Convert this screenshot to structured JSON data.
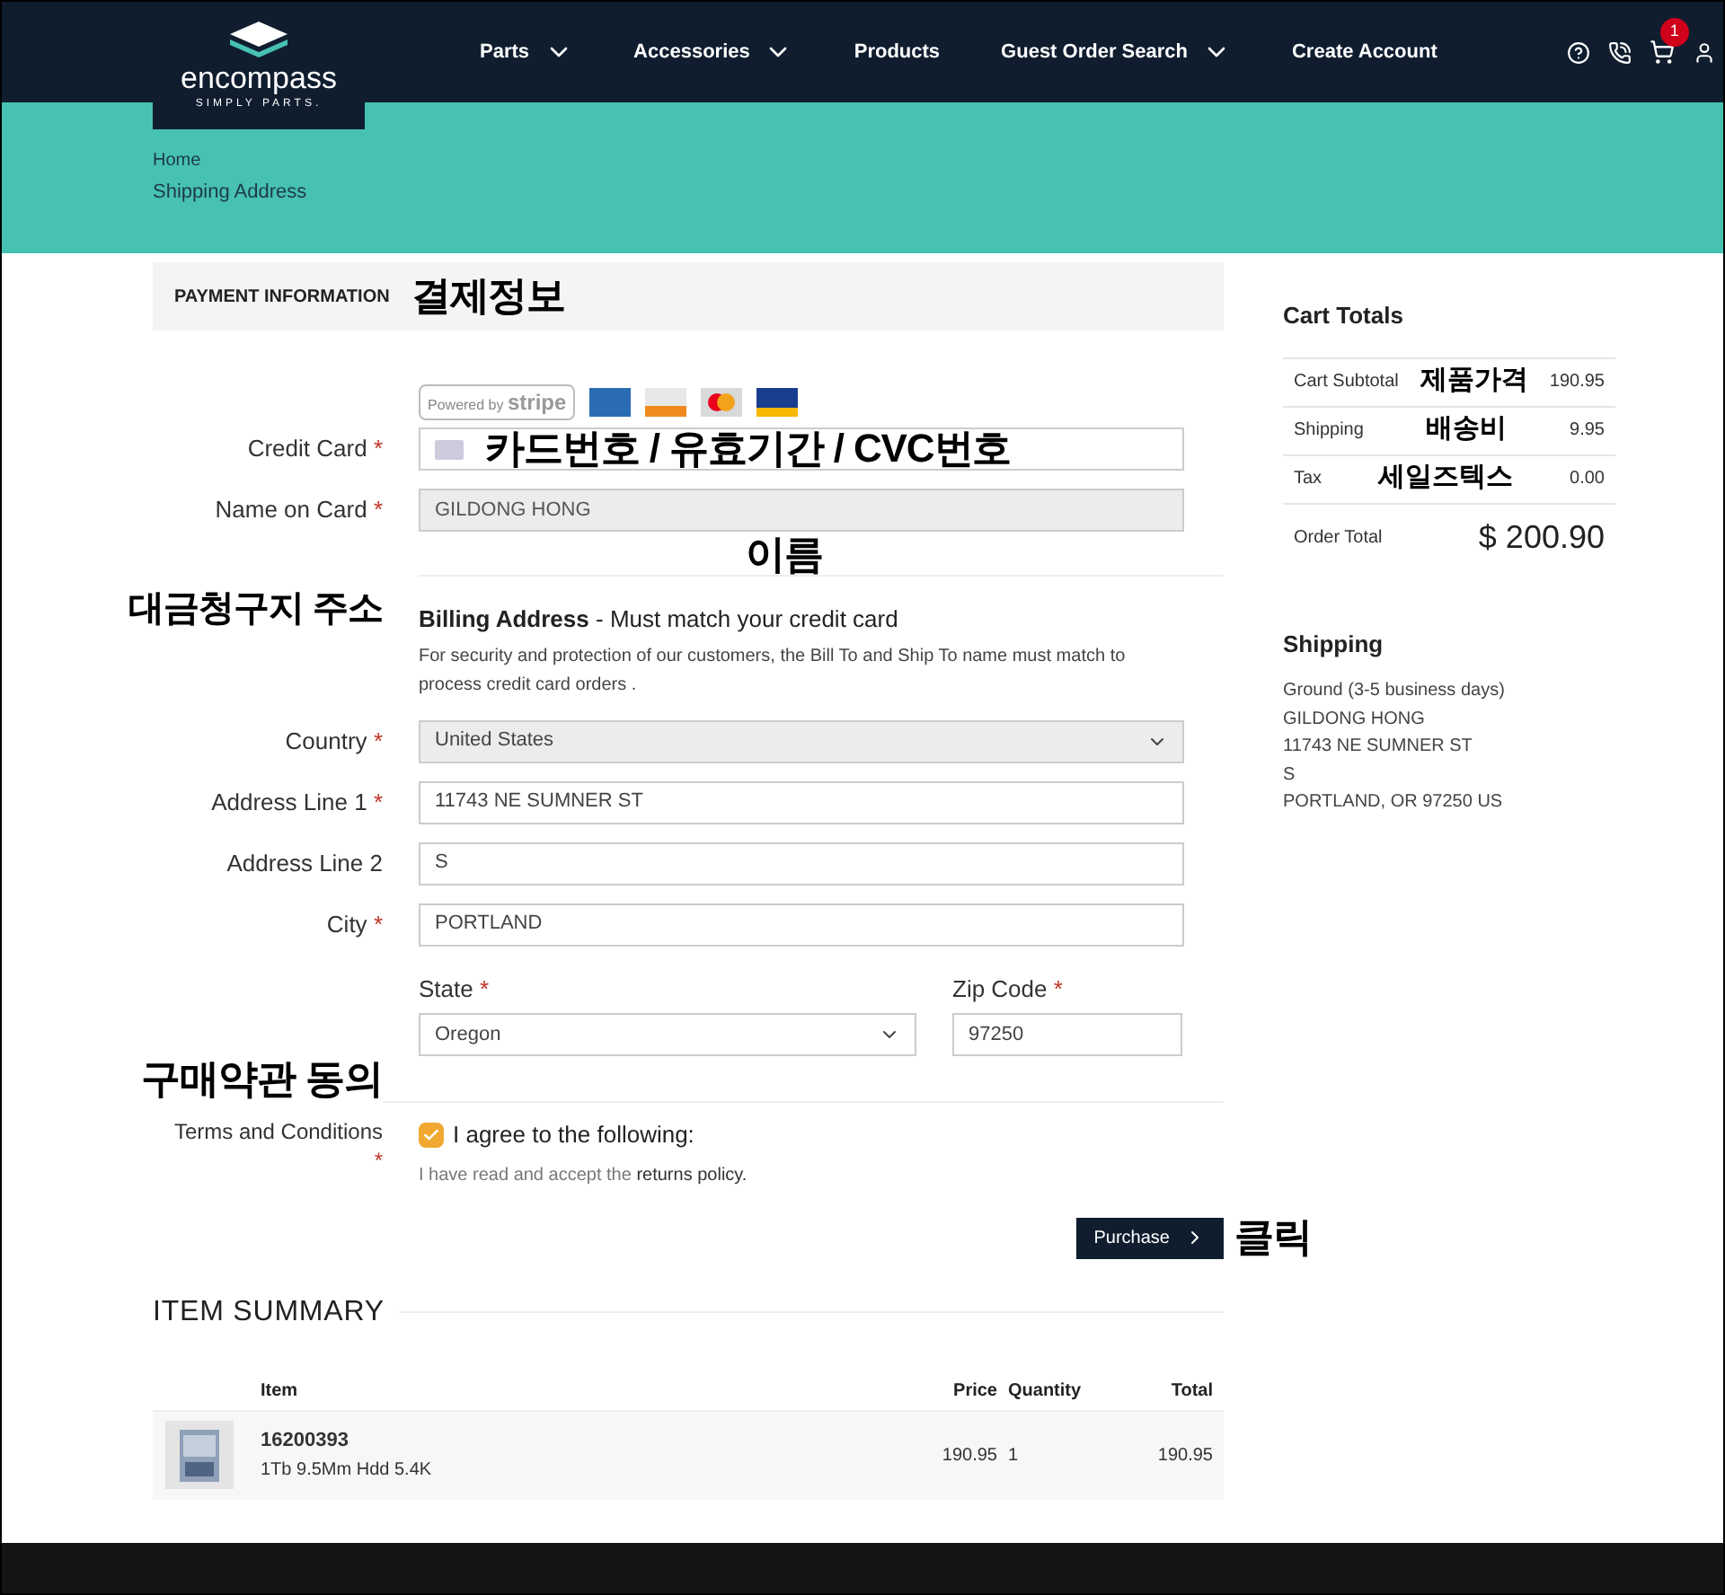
{
  "header": {
    "logo": {
      "name": "encompass",
      "tagline": "SIMPLY PARTS."
    },
    "nav": [
      {
        "label": "Parts",
        "dropdown": true
      },
      {
        "label": "Accessories",
        "dropdown": true
      },
      {
        "label": "Products",
        "dropdown": false
      },
      {
        "label": "Guest Order Search",
        "dropdown": true
      },
      {
        "label": "Create Account",
        "dropdown": false
      }
    ],
    "cart_count": "1"
  },
  "breadcrumb": [
    "Home",
    "Shipping Address"
  ],
  "payment": {
    "title": "PAYMENT INFORMATION",
    "note": "결제정보",
    "stripe": {
      "prefix": "Powered by",
      "brand": "stripe"
    },
    "credit_card": {
      "label": "Credit Card",
      "required": "*",
      "note": "카드번호 / 유효기간 / CVC번호"
    },
    "name_on_card": {
      "label": "Name on Card",
      "required": "*",
      "value": "GILDONG HONG",
      "note": "이름"
    }
  },
  "billing": {
    "note": "대금청구지 주소",
    "title": "Billing Address",
    "subtitle": "- Must match your credit card",
    "description": "For security and protection of our customers, the Bill To and Ship To name must match to process credit card orders .",
    "fields": [
      {
        "kind": "select",
        "label": "Country",
        "required": "*",
        "value": "United States"
      },
      {
        "kind": "text",
        "label": "Address Line 1",
        "required": "*",
        "value": "11743 NE SUMNER ST"
      },
      {
        "kind": "text",
        "label": "Address Line 2",
        "value": "S"
      },
      {
        "kind": "text",
        "label": "City",
        "required": "*",
        "value": "PORTLAND"
      }
    ],
    "state": {
      "label": "State",
      "required": "*",
      "value": "Oregon"
    },
    "zip": {
      "label": "Zip Code",
      "required": "*",
      "value": "97250"
    }
  },
  "terms": {
    "note": "구매약관 동의",
    "label": "Terms and Conditions",
    "required": "*",
    "checked": true,
    "agree": "I agree to the following:",
    "text": "I have read and accept the",
    "link": "returns policy."
  },
  "purchase": {
    "label": "Purchase",
    "note": "클릭"
  },
  "summary": {
    "title": "ITEM SUMMARY",
    "columns": [
      "Item",
      "Price",
      "Quantity",
      "Total"
    ],
    "rows": [
      {
        "number": "16200393",
        "description": "1Tb 9.5Mm Hdd 5.4K",
        "price": "190.95",
        "quantity": "1",
        "total": "190.95"
      }
    ]
  },
  "cart_totals": {
    "title": "Cart Totals",
    "rows": [
      {
        "label": "Cart Subtotal",
        "note": "제품가격",
        "value": "190.95"
      },
      {
        "label": "Shipping",
        "note": "배송비",
        "value": "9.95"
      },
      {
        "label": "Tax",
        "note": "세일즈텍스",
        "value": "0.00"
      }
    ],
    "total_label": "Order Total",
    "total": "$ 200.90"
  },
  "shipping": {
    "title": "Shipping",
    "lines": [
      "Ground (3-5 business days)",
      "GILDONG HONG",
      "11743 NE SUMNER ST",
      "S",
      "PORTLAND, OR 97250 US"
    ]
  }
}
